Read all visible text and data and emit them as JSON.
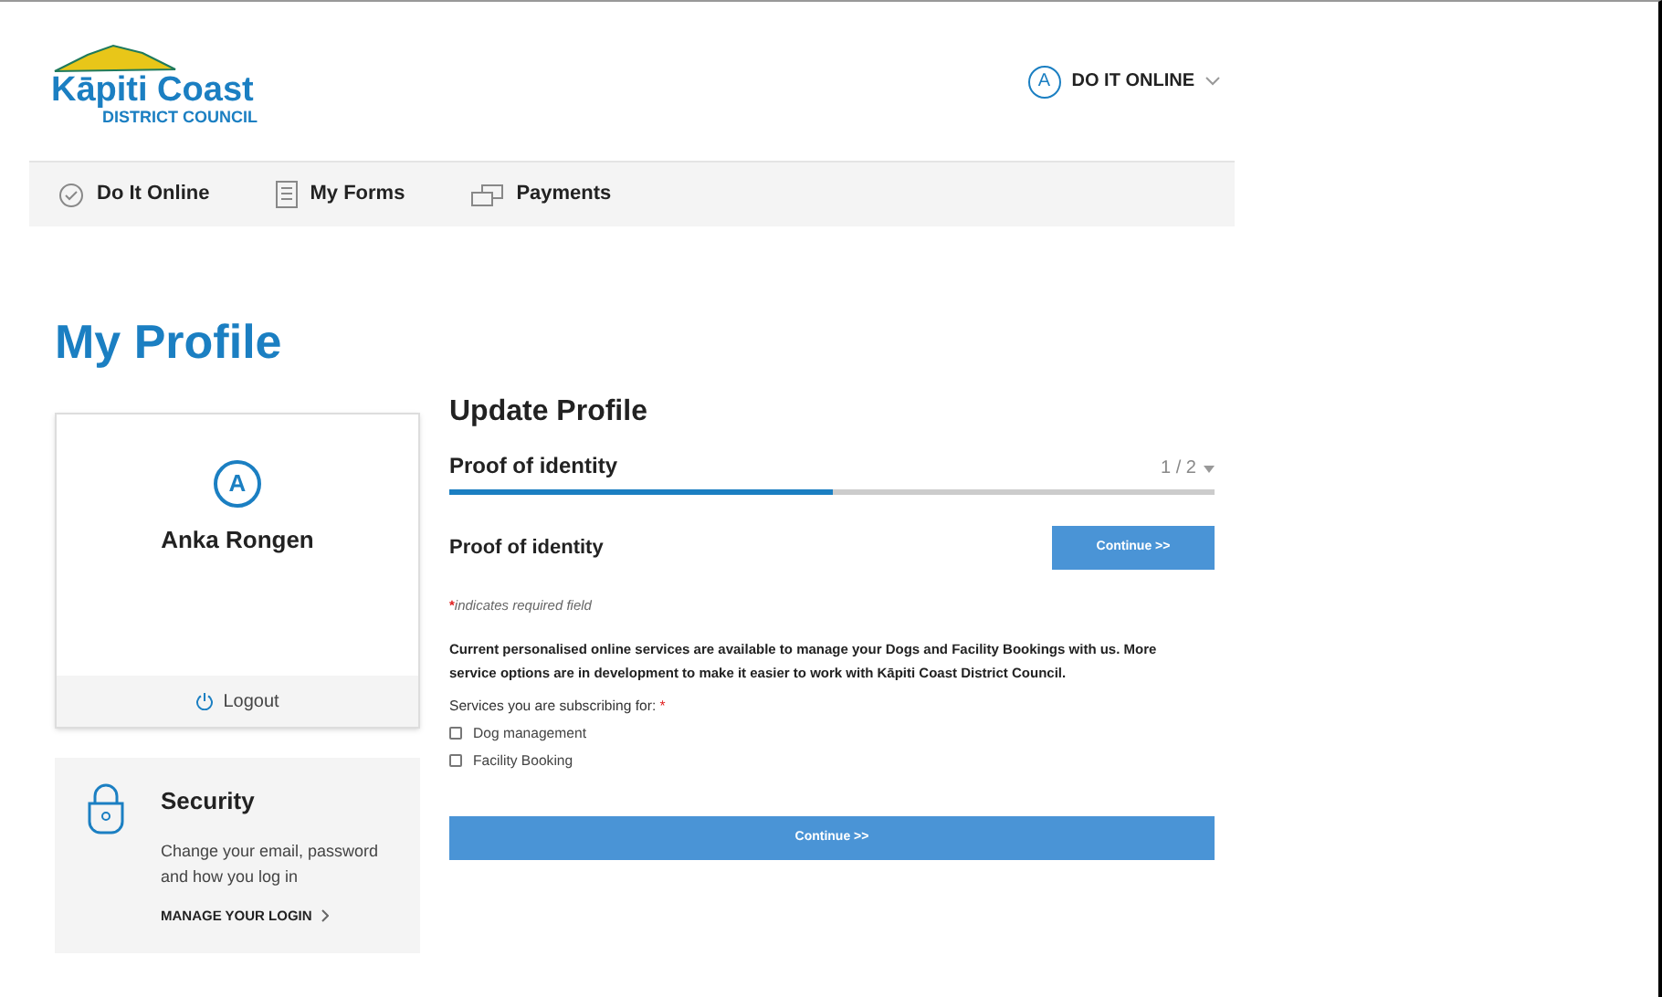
{
  "logo": {
    "name": "Kāpiti Coast",
    "subtitle": "DISTRICT COUNCIL"
  },
  "account_menu": {
    "avatar": "A",
    "label": "DO IT ONLINE"
  },
  "nav": [
    {
      "label": "Do It Online",
      "kind": "check"
    },
    {
      "label": "My Forms",
      "kind": "form"
    },
    {
      "label": "Payments",
      "kind": "cards"
    }
  ],
  "page_title": "My Profile",
  "profile_card": {
    "avatar": "A",
    "name": "Anka Rongen",
    "logout": "Logout"
  },
  "security_card": {
    "title": "Security",
    "description": "Change your email, password and how you log in",
    "link": "MANAGE YOUR LOGIN"
  },
  "form": {
    "title": "Update Profile",
    "step_title": "Proof of identity",
    "step_counter": "1 / 2",
    "level": 0.5,
    "section_title": "Proof of identity",
    "top_button": "Continue >>",
    "required_note": "indicates required field",
    "required_mark": "*",
    "intro": "Current personalised online services are available to manage your Dogs and Facility Bookings with us. More service options are in development to make it easier to work with Kāpiti Coast District Council.",
    "services_label": "Services you are subscribing for:",
    "services": [
      {
        "label": "Dog management",
        "checked": false
      },
      {
        "label": "Facility Booking",
        "checked": false
      }
    ],
    "bottom_button": "Continue >>"
  }
}
